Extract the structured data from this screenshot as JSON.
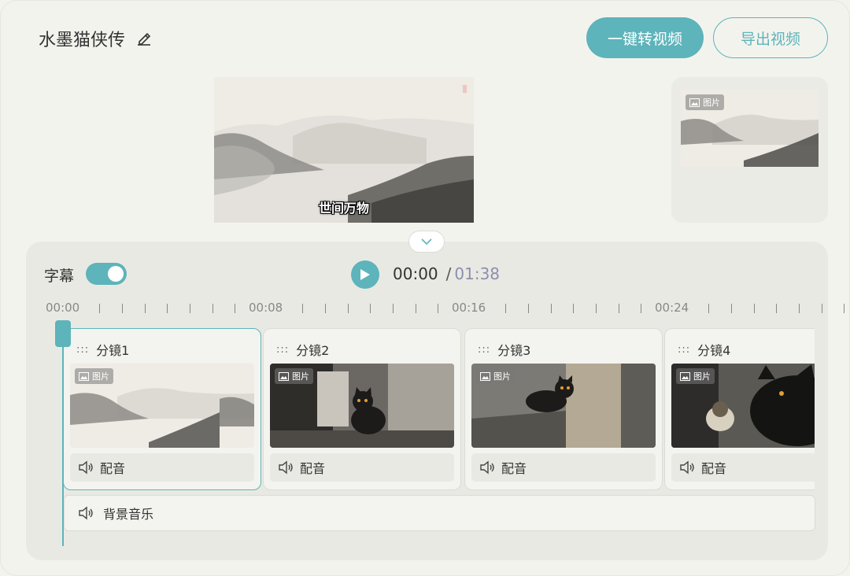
{
  "header": {
    "project_title": "水墨猫侠传",
    "primary_button": "一键转视频",
    "export_button": "导出视频"
  },
  "preview": {
    "subtitle": "世间万物",
    "side_badge": "图片"
  },
  "controls": {
    "subtitle_label": "字幕",
    "subtitle_toggle_on": true,
    "current_time": "00:00",
    "separator": "/",
    "duration": "01:38"
  },
  "timeline": {
    "ticks": [
      "00:00",
      "00:08",
      "00:16",
      "00:24"
    ]
  },
  "shots": [
    {
      "label": "分镜1",
      "badge": "图片",
      "dub_label": "配音",
      "active": true
    },
    {
      "label": "分镜2",
      "badge": "图片",
      "dub_label": "配音",
      "active": false
    },
    {
      "label": "分镜3",
      "badge": "图片",
      "dub_label": "配音",
      "active": false
    },
    {
      "label": "分镜4",
      "badge": "图片",
      "dub_label": "配音",
      "active": false
    }
  ],
  "bgm": {
    "label": "背景音乐"
  },
  "colors": {
    "accent": "#5db4ba",
    "duration": "#8b8fb0",
    "panel": "#e9e9e3"
  }
}
